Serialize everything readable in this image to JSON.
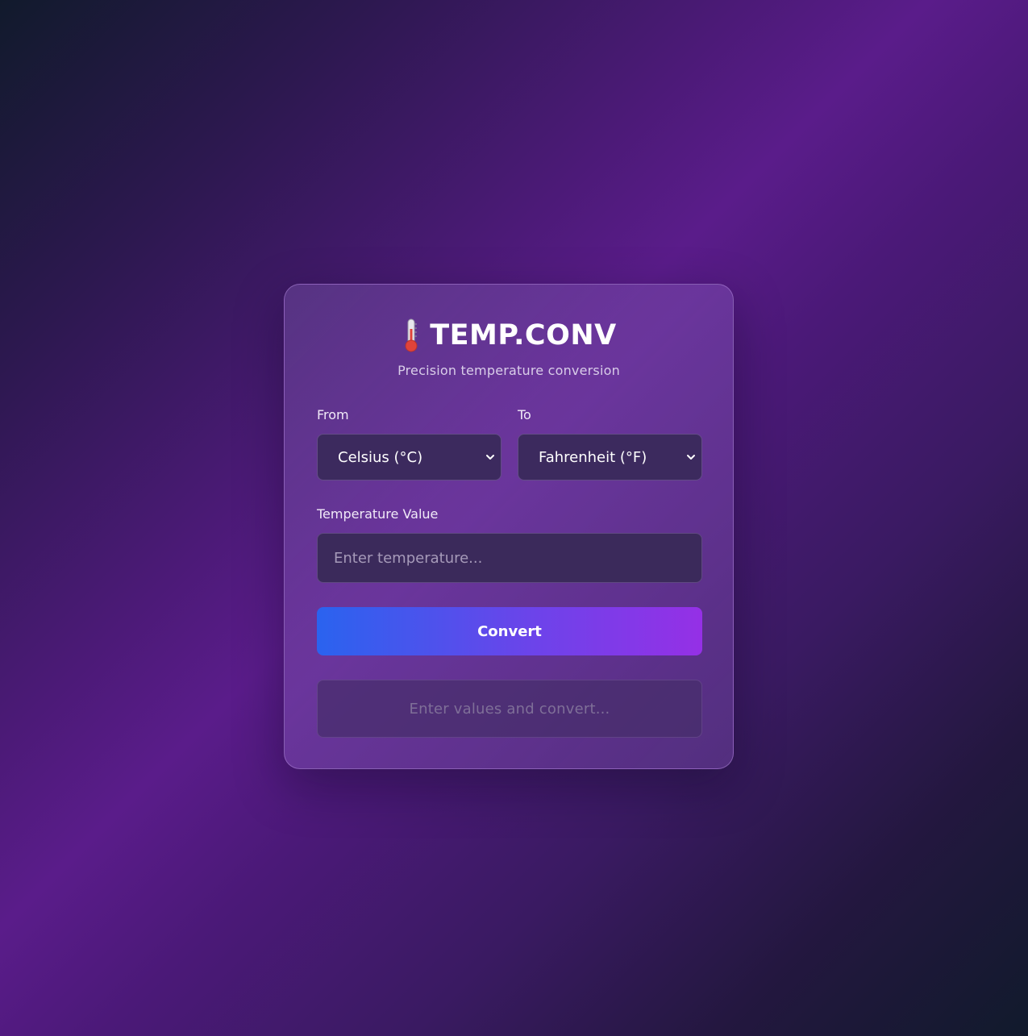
{
  "header": {
    "icon": "thermometer-icon",
    "title": "TEMP.CONV",
    "subtitle": "Precision temperature conversion"
  },
  "from": {
    "label": "From",
    "selected": "Celsius (°C)",
    "icon": "chevron-down-icon"
  },
  "to": {
    "label": "To",
    "selected": "Fahrenheit (°F)",
    "icon": "chevron-down-icon"
  },
  "temperature": {
    "label": "Temperature Value",
    "value": "",
    "placeholder": "Enter temperature..."
  },
  "convert_button": {
    "label": "Convert"
  },
  "result": {
    "text": "Enter values and convert..."
  },
  "colors": {
    "accent_start": "#2a63ef",
    "accent_end": "#9530e6",
    "card_background": "#5f3c8c",
    "background_dark": "#111a2c",
    "background_purple": "#5a1c8a"
  }
}
